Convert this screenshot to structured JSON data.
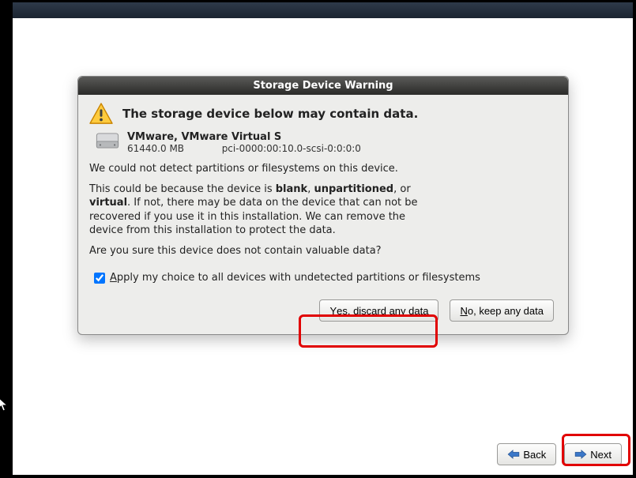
{
  "dialog": {
    "title": "Storage Device Warning",
    "heading": "The storage device below may contain data.",
    "device": {
      "name": "VMware, VMware Virtual S",
      "size": "61440.0 MB",
      "path": "pci-0000:00:10.0-scsi-0:0:0:0"
    },
    "para1": "We could not detect partitions or filesystems on this device.",
    "para2_prefix": "This could be because the device is ",
    "para2_blank": "blank",
    "para2_sep1": ", ",
    "para2_unpartitioned": "unpartitioned",
    "para2_sep2": ", or ",
    "para2_virtual": "virtual",
    "para2_rest": ". If not, there may be data on the device that can not be recovered if you use it in this installation. We can remove the device from this installation to protect the data.",
    "para3": "Are you sure this device does not contain valuable data?",
    "checkbox": {
      "checked": true,
      "mnemonic": "A",
      "label_rest": "pply my choice to all devices with undetected partitions or filesystems"
    },
    "buttons": {
      "yes_mnemonic": "Y",
      "yes_rest": "es, discard any data",
      "no_mnemonic": "N",
      "no_rest": "o, keep any data"
    }
  },
  "footer": {
    "back_mnemonic": "B",
    "back_rest": "ack",
    "next_mnemonic": "N",
    "next_rest": "ext"
  }
}
